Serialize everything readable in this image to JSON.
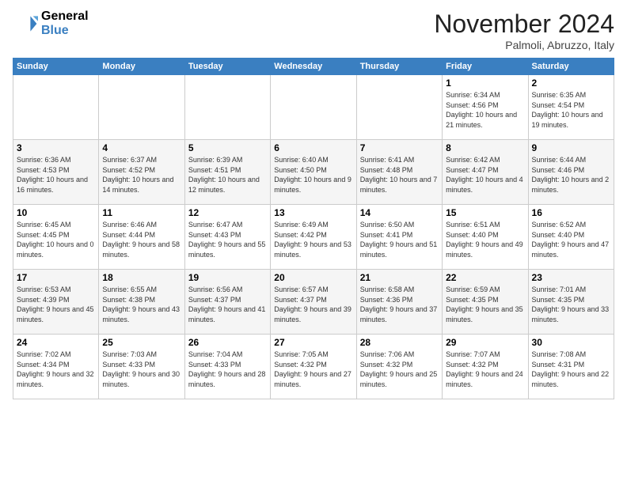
{
  "logo": {
    "line1": "General",
    "line2": "Blue"
  },
  "title": "November 2024",
  "location": "Palmoli, Abruzzo, Italy",
  "weekdays": [
    "Sunday",
    "Monday",
    "Tuesday",
    "Wednesday",
    "Thursday",
    "Friday",
    "Saturday"
  ],
  "weeks": [
    [
      {
        "day": "",
        "info": ""
      },
      {
        "day": "",
        "info": ""
      },
      {
        "day": "",
        "info": ""
      },
      {
        "day": "",
        "info": ""
      },
      {
        "day": "",
        "info": ""
      },
      {
        "day": "1",
        "info": "Sunrise: 6:34 AM\nSunset: 4:56 PM\nDaylight: 10 hours and 21 minutes."
      },
      {
        "day": "2",
        "info": "Sunrise: 6:35 AM\nSunset: 4:54 PM\nDaylight: 10 hours and 19 minutes."
      }
    ],
    [
      {
        "day": "3",
        "info": "Sunrise: 6:36 AM\nSunset: 4:53 PM\nDaylight: 10 hours and 16 minutes."
      },
      {
        "day": "4",
        "info": "Sunrise: 6:37 AM\nSunset: 4:52 PM\nDaylight: 10 hours and 14 minutes."
      },
      {
        "day": "5",
        "info": "Sunrise: 6:39 AM\nSunset: 4:51 PM\nDaylight: 10 hours and 12 minutes."
      },
      {
        "day": "6",
        "info": "Sunrise: 6:40 AM\nSunset: 4:50 PM\nDaylight: 10 hours and 9 minutes."
      },
      {
        "day": "7",
        "info": "Sunrise: 6:41 AM\nSunset: 4:48 PM\nDaylight: 10 hours and 7 minutes."
      },
      {
        "day": "8",
        "info": "Sunrise: 6:42 AM\nSunset: 4:47 PM\nDaylight: 10 hours and 4 minutes."
      },
      {
        "day": "9",
        "info": "Sunrise: 6:44 AM\nSunset: 4:46 PM\nDaylight: 10 hours and 2 minutes."
      }
    ],
    [
      {
        "day": "10",
        "info": "Sunrise: 6:45 AM\nSunset: 4:45 PM\nDaylight: 10 hours and 0 minutes."
      },
      {
        "day": "11",
        "info": "Sunrise: 6:46 AM\nSunset: 4:44 PM\nDaylight: 9 hours and 58 minutes."
      },
      {
        "day": "12",
        "info": "Sunrise: 6:47 AM\nSunset: 4:43 PM\nDaylight: 9 hours and 55 minutes."
      },
      {
        "day": "13",
        "info": "Sunrise: 6:49 AM\nSunset: 4:42 PM\nDaylight: 9 hours and 53 minutes."
      },
      {
        "day": "14",
        "info": "Sunrise: 6:50 AM\nSunset: 4:41 PM\nDaylight: 9 hours and 51 minutes."
      },
      {
        "day": "15",
        "info": "Sunrise: 6:51 AM\nSunset: 4:40 PM\nDaylight: 9 hours and 49 minutes."
      },
      {
        "day": "16",
        "info": "Sunrise: 6:52 AM\nSunset: 4:40 PM\nDaylight: 9 hours and 47 minutes."
      }
    ],
    [
      {
        "day": "17",
        "info": "Sunrise: 6:53 AM\nSunset: 4:39 PM\nDaylight: 9 hours and 45 minutes."
      },
      {
        "day": "18",
        "info": "Sunrise: 6:55 AM\nSunset: 4:38 PM\nDaylight: 9 hours and 43 minutes."
      },
      {
        "day": "19",
        "info": "Sunrise: 6:56 AM\nSunset: 4:37 PM\nDaylight: 9 hours and 41 minutes."
      },
      {
        "day": "20",
        "info": "Sunrise: 6:57 AM\nSunset: 4:37 PM\nDaylight: 9 hours and 39 minutes."
      },
      {
        "day": "21",
        "info": "Sunrise: 6:58 AM\nSunset: 4:36 PM\nDaylight: 9 hours and 37 minutes."
      },
      {
        "day": "22",
        "info": "Sunrise: 6:59 AM\nSunset: 4:35 PM\nDaylight: 9 hours and 35 minutes."
      },
      {
        "day": "23",
        "info": "Sunrise: 7:01 AM\nSunset: 4:35 PM\nDaylight: 9 hours and 33 minutes."
      }
    ],
    [
      {
        "day": "24",
        "info": "Sunrise: 7:02 AM\nSunset: 4:34 PM\nDaylight: 9 hours and 32 minutes."
      },
      {
        "day": "25",
        "info": "Sunrise: 7:03 AM\nSunset: 4:33 PM\nDaylight: 9 hours and 30 minutes."
      },
      {
        "day": "26",
        "info": "Sunrise: 7:04 AM\nSunset: 4:33 PM\nDaylight: 9 hours and 28 minutes."
      },
      {
        "day": "27",
        "info": "Sunrise: 7:05 AM\nSunset: 4:32 PM\nDaylight: 9 hours and 27 minutes."
      },
      {
        "day": "28",
        "info": "Sunrise: 7:06 AM\nSunset: 4:32 PM\nDaylight: 9 hours and 25 minutes."
      },
      {
        "day": "29",
        "info": "Sunrise: 7:07 AM\nSunset: 4:32 PM\nDaylight: 9 hours and 24 minutes."
      },
      {
        "day": "30",
        "info": "Sunrise: 7:08 AM\nSunset: 4:31 PM\nDaylight: 9 hours and 22 minutes."
      }
    ]
  ]
}
